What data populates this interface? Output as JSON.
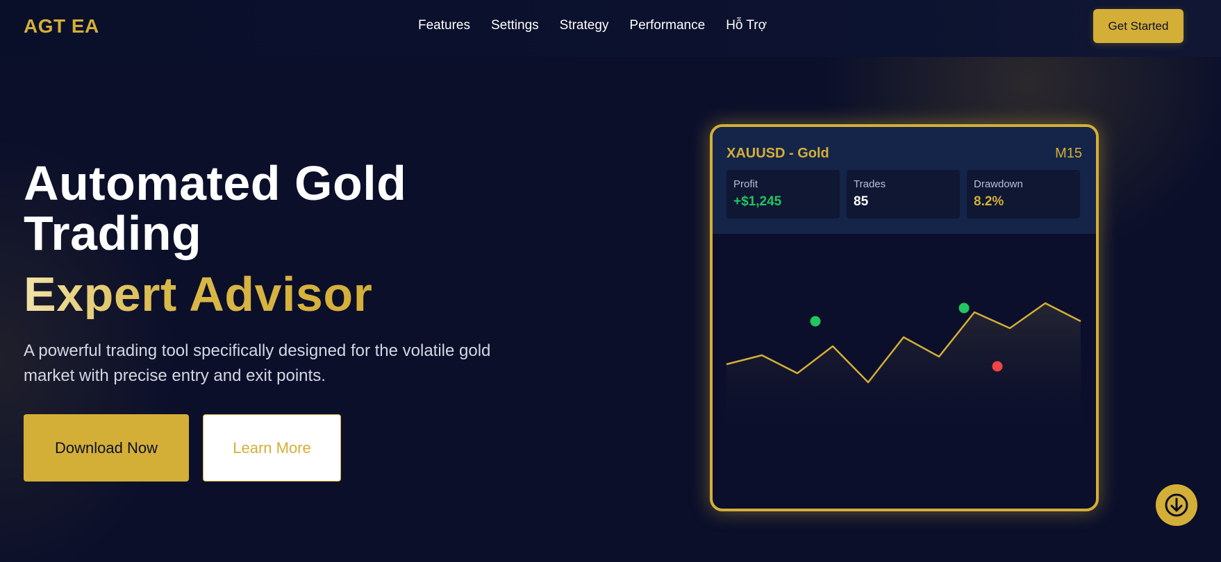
{
  "nav": {
    "brand": "AGT EA",
    "links": [
      "Features",
      "Settings",
      "Strategy",
      "Performance",
      "Hỗ Trợ"
    ],
    "cta": "Get Started"
  },
  "hero": {
    "title": "Automated Gold Trading",
    "subtitle": "Expert Advisor",
    "description": "A powerful trading tool specifically designed for the volatile gold market with precise entry and exit points.",
    "primary_button": "Download Now",
    "secondary_button": "Learn More"
  },
  "card": {
    "symbol": "XAUUSD - Gold",
    "timeframe": "M15",
    "stats": [
      {
        "label": "Profit",
        "value": "+$1,245",
        "color": "#22c55e"
      },
      {
        "label": "Trades",
        "value": "85",
        "color": "#ffffff"
      },
      {
        "label": "Drawdown",
        "value": "8.2%",
        "color": "#d4af37"
      }
    ]
  },
  "colors": {
    "gold": "#d4af37",
    "navy": "#0b0f2a",
    "buy": "#22c55e",
    "sell": "#ef4444"
  },
  "icons": {
    "scroll": "arrow-down-circle-icon"
  }
}
